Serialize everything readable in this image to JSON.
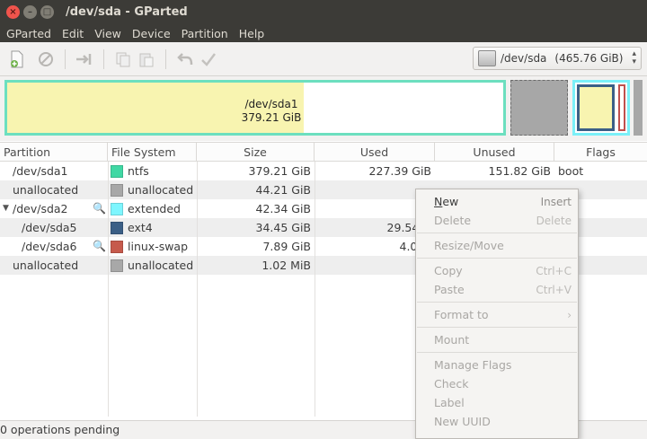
{
  "window": {
    "title": "/dev/sda - GParted"
  },
  "menubar": [
    "GParted",
    "Edit",
    "View",
    "Device",
    "Partition",
    "Help"
  ],
  "toolbar": {
    "buttons": [
      "new-icon",
      "delete-icon",
      "resize-move-icon",
      "copy-icon",
      "paste-icon",
      "undo-icon",
      "apply-icon"
    ],
    "device_select": {
      "device": "/dev/sda",
      "size": "(465.76 GiB)"
    }
  },
  "partition_map": {
    "sda1_label": "/dev/sda1",
    "sda1_size": "379.21 GiB",
    "colors": {
      "ntfs": "#6cdfbf",
      "used": "#f8f4b0",
      "unallocated": "#a7a7a7",
      "extended": "#7bf0f8",
      "ext4": "#3b5f86",
      "linux_swap": "#c0504d"
    }
  },
  "table": {
    "columns": [
      "Partition",
      "File System",
      "Size",
      "Used",
      "Unused",
      "Flags"
    ],
    "rows": [
      {
        "partition": "/dev/sda1",
        "fs": "ntfs",
        "color": "#40d8a4",
        "size": "379.21 GiB",
        "used": "227.39 GiB",
        "unused": "151.82 GiB",
        "flags": "boot"
      },
      {
        "partition": "unallocated",
        "fs": "unallocated",
        "color": "#a8a8a8",
        "size": "44.21 GiB",
        "used": "",
        "unused": "",
        "flags": ""
      },
      {
        "partition": "/dev/sda2",
        "fs": "extended",
        "color": "#7ef6ff",
        "size": "42.34 GiB",
        "used": "",
        "unused": "",
        "flags": ""
      },
      {
        "partition": "/dev/sda5",
        "fs": "ext4",
        "color": "#3b5f86",
        "size": "34.45 GiB",
        "used": "29.54 G",
        "unused": "",
        "flags": ""
      },
      {
        "partition": "/dev/sda6",
        "fs": "linux-swap",
        "color": "#c65a4c",
        "size": "7.89 GiB",
        "used": "4.00 I",
        "unused": "",
        "flags": ""
      },
      {
        "partition": "unallocated",
        "fs": "unallocated",
        "color": "#a8a8a8",
        "size": "1.02 MiB",
        "used": "",
        "unused": "",
        "flags": ""
      }
    ]
  },
  "context_menu": {
    "new": {
      "label_underlined": "N",
      "label_rest": "ew",
      "accel": "Insert"
    },
    "delete": {
      "label": "Delete",
      "accel": "Delete"
    },
    "resize_move": {
      "label": "Resize/Move"
    },
    "copy": {
      "label": "Copy",
      "accel": "Ctrl+C"
    },
    "paste": {
      "label": "Paste",
      "accel": "Ctrl+V"
    },
    "format_to": {
      "label": "Format to",
      "accel": "›"
    },
    "mount": {
      "label": "Mount"
    },
    "manage_flags": {
      "label": "Manage Flags"
    },
    "check": {
      "label": "Check"
    },
    "label": {
      "label": "Label"
    },
    "new_uuid": {
      "label": "New UUID"
    }
  },
  "statusbar": {
    "text": "0 operations pending"
  }
}
